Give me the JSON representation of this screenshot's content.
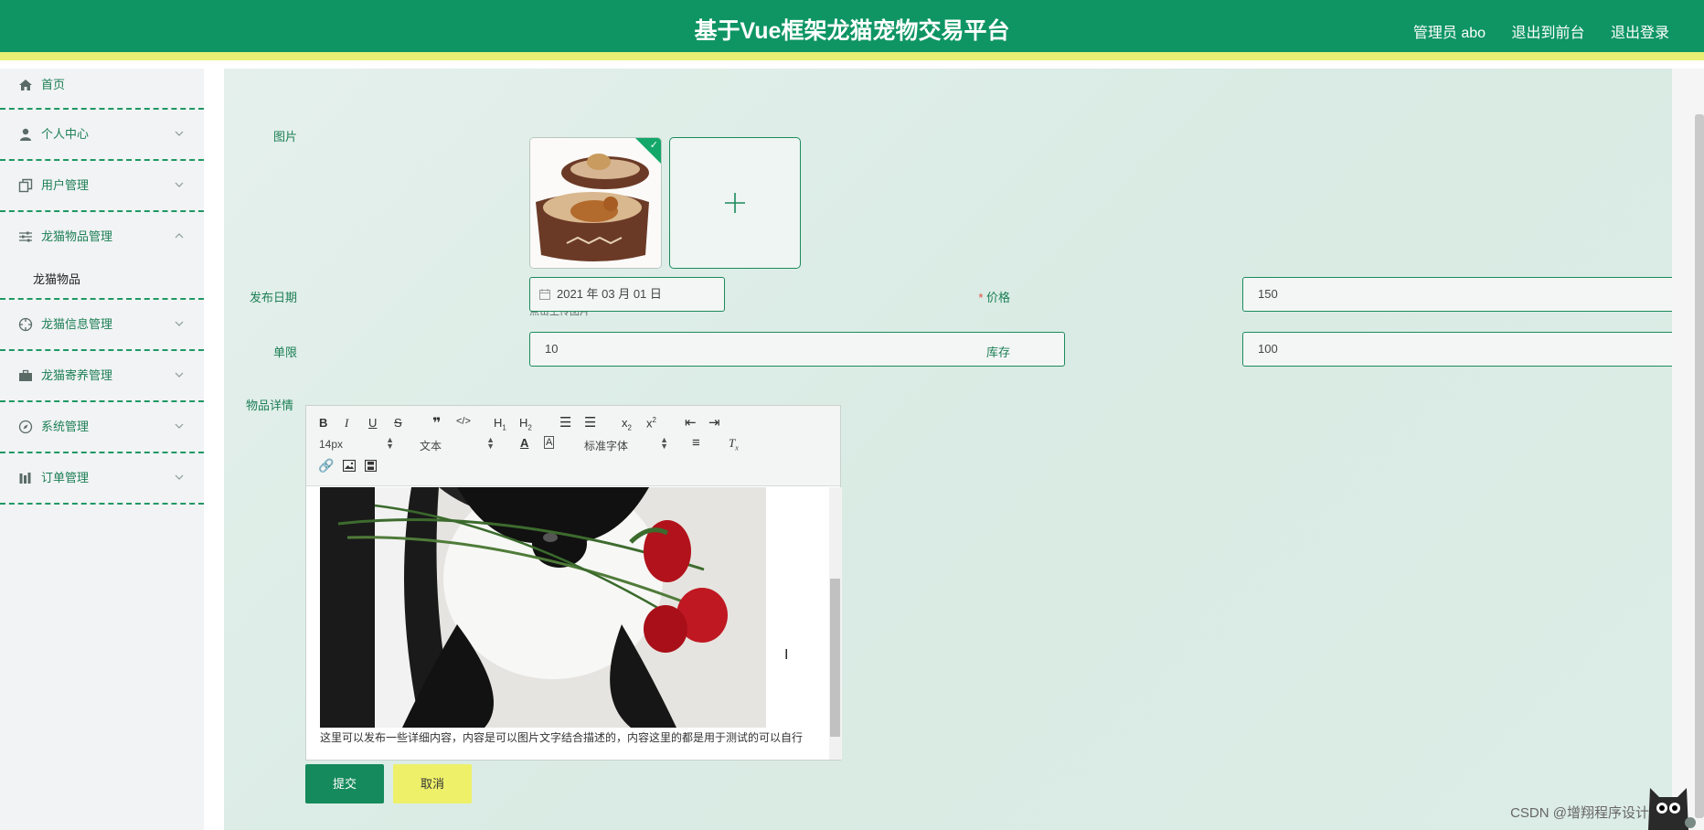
{
  "header": {
    "title": "基于Vue框架龙猫宠物交易平台",
    "admin": "管理员 abo",
    "exit_front": "退出到前台",
    "logout": "退出登录"
  },
  "sidebar": {
    "items": [
      {
        "label": "首页",
        "icon": "home-icon"
      },
      {
        "label": "个人中心",
        "icon": "user-icon"
      },
      {
        "label": "用户管理",
        "icon": "copy-icon"
      },
      {
        "label": "龙猫物品管理",
        "icon": "sliders-icon",
        "sub": "龙猫物品"
      },
      {
        "label": "龙猫信息管理",
        "icon": "dial-icon"
      },
      {
        "label": "龙猫寄养管理",
        "icon": "briefcase-icon"
      },
      {
        "label": "系统管理",
        "icon": "compass-icon"
      },
      {
        "label": "订单管理",
        "icon": "chart-icon"
      }
    ]
  },
  "form": {
    "image_label": "图片",
    "upload_hint": "点击上传图片",
    "date_label": "发布日期",
    "date_value": "2021 年 03 月 01 日",
    "price_label": "价格",
    "price_value": "150",
    "limit_label": "单限",
    "limit_value": "10",
    "stock_label": "库存",
    "stock_value": "100",
    "detail_label": "物品详情",
    "editor": {
      "font_size": "14px",
      "paragraph": "文本",
      "font_family": "标准字体",
      "content": "这里可以发布一些详细内容，内容是可以图片文字结合描述的，内容这里的都是用于测试的可以自行"
    },
    "submit_label": "提交",
    "cancel_label": "取消"
  },
  "watermark": "CSDN @增翔程序设计",
  "colors": {
    "primary": "#0e9563",
    "accent_yellow": "#e9ee74",
    "main_bg": "#dcece6",
    "required": "#e04a3f"
  }
}
